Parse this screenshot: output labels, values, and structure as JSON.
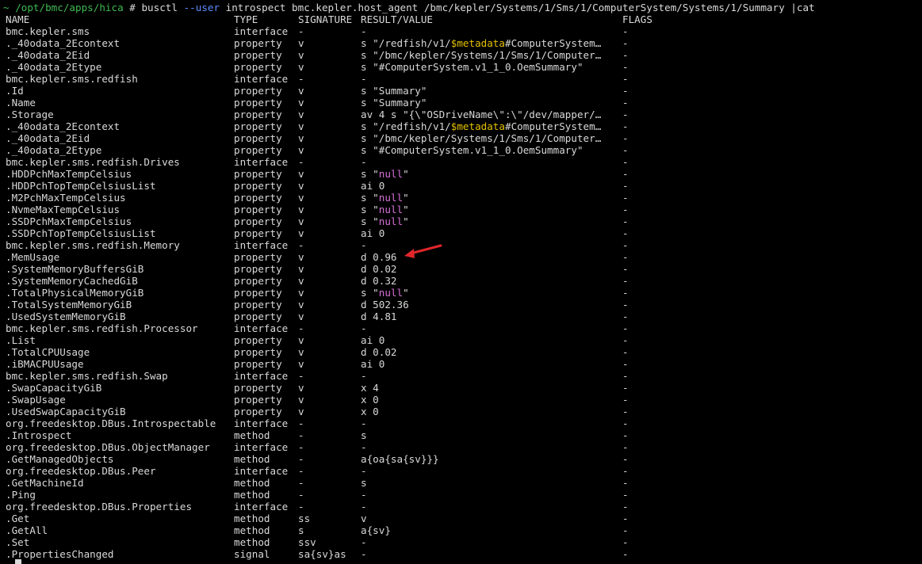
{
  "terminal": {
    "prompt_tilde": "~",
    "prompt_path": "/opt/bmc/apps/hica",
    "prompt_hash": "#",
    "cmd_part1": "busctl",
    "cmd_option": "--user",
    "cmd_part2": "introspect bmc.kepler.host_agent /bmc/kepler/Systems/1/Sms/1/ComputerSystem/Systems/1/Summary |cat",
    "bottom_prompt": "~ ",
    "colors": {
      "background": "#000000",
      "text": "#d9d9d9",
      "prompt_green": "#3fb950",
      "option_blue": "#5b8cff",
      "metadata_yellow": "#e3c000",
      "null_magenta": "#d670d6",
      "arrow_red": "#e0262b"
    },
    "headers": {
      "name": "NAME",
      "type": "TYPE",
      "signature": "SIGNATURE",
      "value": "RESULT/VALUE",
      "flags": "FLAGS"
    },
    "rows": [
      {
        "name": "bmc.kepler.sms",
        "type": "interface",
        "sig": "-",
        "v1": "-",
        "v2": "",
        "v3": "",
        "flags": "-"
      },
      {
        "name": "._40odata_2Econtext",
        "type": "property",
        "sig": "v",
        "v1": "s \"/redfish/v1/",
        "v2": "$metadata",
        "v3": "#ComputerSystem…",
        "flags": "-"
      },
      {
        "name": "._40odata_2Eid",
        "type": "property",
        "sig": "v",
        "v1": "s \"/bmc/kepler/Systems/1/Sms/1/Computer…",
        "v2": "",
        "v3": "",
        "flags": "-"
      },
      {
        "name": "._40odata_2Etype",
        "type": "property",
        "sig": "v",
        "v1": "s \"#ComputerSystem.v1_1_0.OemSummary\"",
        "v2": "",
        "v3": "",
        "flags": "-"
      },
      {
        "name": "bmc.kepler.sms.redfish",
        "type": "interface",
        "sig": "-",
        "v1": "-",
        "v2": "",
        "v3": "",
        "flags": "-"
      },
      {
        "name": ".Id",
        "type": "property",
        "sig": "v",
        "v1": "s \"Summary\"",
        "v2": "",
        "v3": "",
        "flags": "-"
      },
      {
        "name": ".Name",
        "type": "property",
        "sig": "v",
        "v1": "s \"Summary\"",
        "v2": "",
        "v3": "",
        "flags": "-"
      },
      {
        "name": ".Storage",
        "type": "property",
        "sig": "v",
        "v1": "av 4 s \"{\\\"OSDriveName\\\":\\\"/dev/mapper/…",
        "v2": "",
        "v3": "",
        "flags": "-"
      },
      {
        "name": "._40odata_2Econtext",
        "type": "property",
        "sig": "v",
        "v1": "s \"/redfish/v1/",
        "v2": "$metadata",
        "v3": "#ComputerSystem…",
        "flags": "-"
      },
      {
        "name": "._40odata_2Eid",
        "type": "property",
        "sig": "v",
        "v1": "s \"/bmc/kepler/Systems/1/Sms/1/Computer…",
        "v2": "",
        "v3": "",
        "flags": "-"
      },
      {
        "name": "._40odata_2Etype",
        "type": "property",
        "sig": "v",
        "v1": "s \"#ComputerSystem.v1_1_0.OemSummary\"",
        "v2": "",
        "v3": "",
        "flags": "-"
      },
      {
        "name": "bmc.kepler.sms.redfish.Drives",
        "type": "interface",
        "sig": "-",
        "v1": "-",
        "v2": "",
        "v3": "",
        "flags": "-"
      },
      {
        "name": ".HDDPchMaxTempCelsius",
        "type": "property",
        "sig": "v",
        "v1": "s \"",
        "v2": "",
        "v3": "\"",
        "nul": "null",
        "flags": "-"
      },
      {
        "name": ".HDDPchTopTempCelsiusList",
        "type": "property",
        "sig": "v",
        "v1": "ai 0",
        "v2": "",
        "v3": "",
        "flags": "-"
      },
      {
        "name": ".M2PchMaxTempCelsius",
        "type": "property",
        "sig": "v",
        "v1": "s \"",
        "v2": "",
        "v3": "\"",
        "nul": "null",
        "flags": "-"
      },
      {
        "name": ".NvmeMaxTempCelsius",
        "type": "property",
        "sig": "v",
        "v1": "s \"",
        "v2": "",
        "v3": "\"",
        "nul": "null",
        "flags": "-"
      },
      {
        "name": ".SSDPchMaxTempCelsius",
        "type": "property",
        "sig": "v",
        "v1": "s \"",
        "v2": "",
        "v3": "\"",
        "nul": "null",
        "flags": "-"
      },
      {
        "name": ".SSDPchTopTempCelsiusList",
        "type": "property",
        "sig": "v",
        "v1": "ai 0",
        "v2": "",
        "v3": "",
        "flags": "-"
      },
      {
        "name": "bmc.kepler.sms.redfish.Memory",
        "type": "interface",
        "sig": "-",
        "v1": "-",
        "v2": "",
        "v3": "",
        "flags": "-"
      },
      {
        "name": ".MemUsage",
        "type": "property",
        "sig": "v",
        "v1": "d 0.96",
        "v2": "",
        "v3": "",
        "flags": "-"
      },
      {
        "name": ".SystemMemoryBuffersGiB",
        "type": "property",
        "sig": "v",
        "v1": "d 0.02",
        "v2": "",
        "v3": "",
        "flags": "-"
      },
      {
        "name": ".SystemMemoryCachedGiB",
        "type": "property",
        "sig": "v",
        "v1": "d 0.32",
        "v2": "",
        "v3": "",
        "flags": "-"
      },
      {
        "name": ".TotalPhysicalMemoryGiB",
        "type": "property",
        "sig": "v",
        "v1": "s \"",
        "v2": "",
        "v3": "\"",
        "nul": "null",
        "flags": "-"
      },
      {
        "name": ".TotalSystemMemoryGiB",
        "type": "property",
        "sig": "v",
        "v1": "d 502.36",
        "v2": "",
        "v3": "",
        "flags": "-"
      },
      {
        "name": ".UsedSystemMemoryGiB",
        "type": "property",
        "sig": "v",
        "v1": "d 4.81",
        "v2": "",
        "v3": "",
        "flags": "-"
      },
      {
        "name": "bmc.kepler.sms.redfish.Processor",
        "type": "interface",
        "sig": "-",
        "v1": "-",
        "v2": "",
        "v3": "",
        "flags": "-"
      },
      {
        "name": ".List",
        "type": "property",
        "sig": "v",
        "v1": "ai 0",
        "v2": "",
        "v3": "",
        "flags": "-"
      },
      {
        "name": ".TotalCPUUsage",
        "type": "property",
        "sig": "v",
        "v1": "d 0.02",
        "v2": "",
        "v3": "",
        "flags": "-"
      },
      {
        "name": ".iBMACPUUsage",
        "type": "property",
        "sig": "v",
        "v1": "ai 0",
        "v2": "",
        "v3": "",
        "flags": "-"
      },
      {
        "name": "bmc.kepler.sms.redfish.Swap",
        "type": "interface",
        "sig": "-",
        "v1": "-",
        "v2": "",
        "v3": "",
        "flags": "-"
      },
      {
        "name": ".SwapCapacityGiB",
        "type": "property",
        "sig": "v",
        "v1": "x 4",
        "v2": "",
        "v3": "",
        "flags": "-"
      },
      {
        "name": ".SwapUsage",
        "type": "property",
        "sig": "v",
        "v1": "x 0",
        "v2": "",
        "v3": "",
        "flags": "-"
      },
      {
        "name": ".UsedSwapCapacityGiB",
        "type": "property",
        "sig": "v",
        "v1": "x 0",
        "v2": "",
        "v3": "",
        "flags": "-"
      },
      {
        "name": "org.freedesktop.DBus.Introspectable",
        "type": "interface",
        "sig": "-",
        "v1": "-",
        "v2": "",
        "v3": "",
        "flags": "-"
      },
      {
        "name": ".Introspect",
        "type": "method",
        "sig": "-",
        "v1": "s",
        "v2": "",
        "v3": "",
        "flags": "-"
      },
      {
        "name": "org.freedesktop.DBus.ObjectManager",
        "type": "interface",
        "sig": "-",
        "v1": "-",
        "v2": "",
        "v3": "",
        "flags": "-"
      },
      {
        "name": ".GetManagedObjects",
        "type": "method",
        "sig": "-",
        "v1": "a{oa{sa{sv}}}",
        "v2": "",
        "v3": "",
        "flags": "-"
      },
      {
        "name": "org.freedesktop.DBus.Peer",
        "type": "interface",
        "sig": "-",
        "v1": "-",
        "v2": "",
        "v3": "",
        "flags": "-"
      },
      {
        "name": ".GetMachineId",
        "type": "method",
        "sig": "-",
        "v1": "s",
        "v2": "",
        "v3": "",
        "flags": "-"
      },
      {
        "name": ".Ping",
        "type": "method",
        "sig": "-",
        "v1": "-",
        "v2": "",
        "v3": "",
        "flags": "-"
      },
      {
        "name": "org.freedesktop.DBus.Properties",
        "type": "interface",
        "sig": "-",
        "v1": "-",
        "v2": "",
        "v3": "",
        "flags": "-"
      },
      {
        "name": ".Get",
        "type": "method",
        "sig": "ss",
        "v1": "v",
        "v2": "",
        "v3": "",
        "flags": "-"
      },
      {
        "name": ".GetAll",
        "type": "method",
        "sig": "s",
        "v1": "a{sv}",
        "v2": "",
        "v3": "",
        "flags": "-"
      },
      {
        "name": ".Set",
        "type": "method",
        "sig": "ssv",
        "v1": "-",
        "v2": "",
        "v3": "",
        "flags": "-"
      },
      {
        "name": ".PropertiesChanged",
        "type": "signal",
        "sig": "sa{sv}as",
        "v1": "-",
        "v2": "",
        "v3": "",
        "flags": "-"
      }
    ]
  }
}
